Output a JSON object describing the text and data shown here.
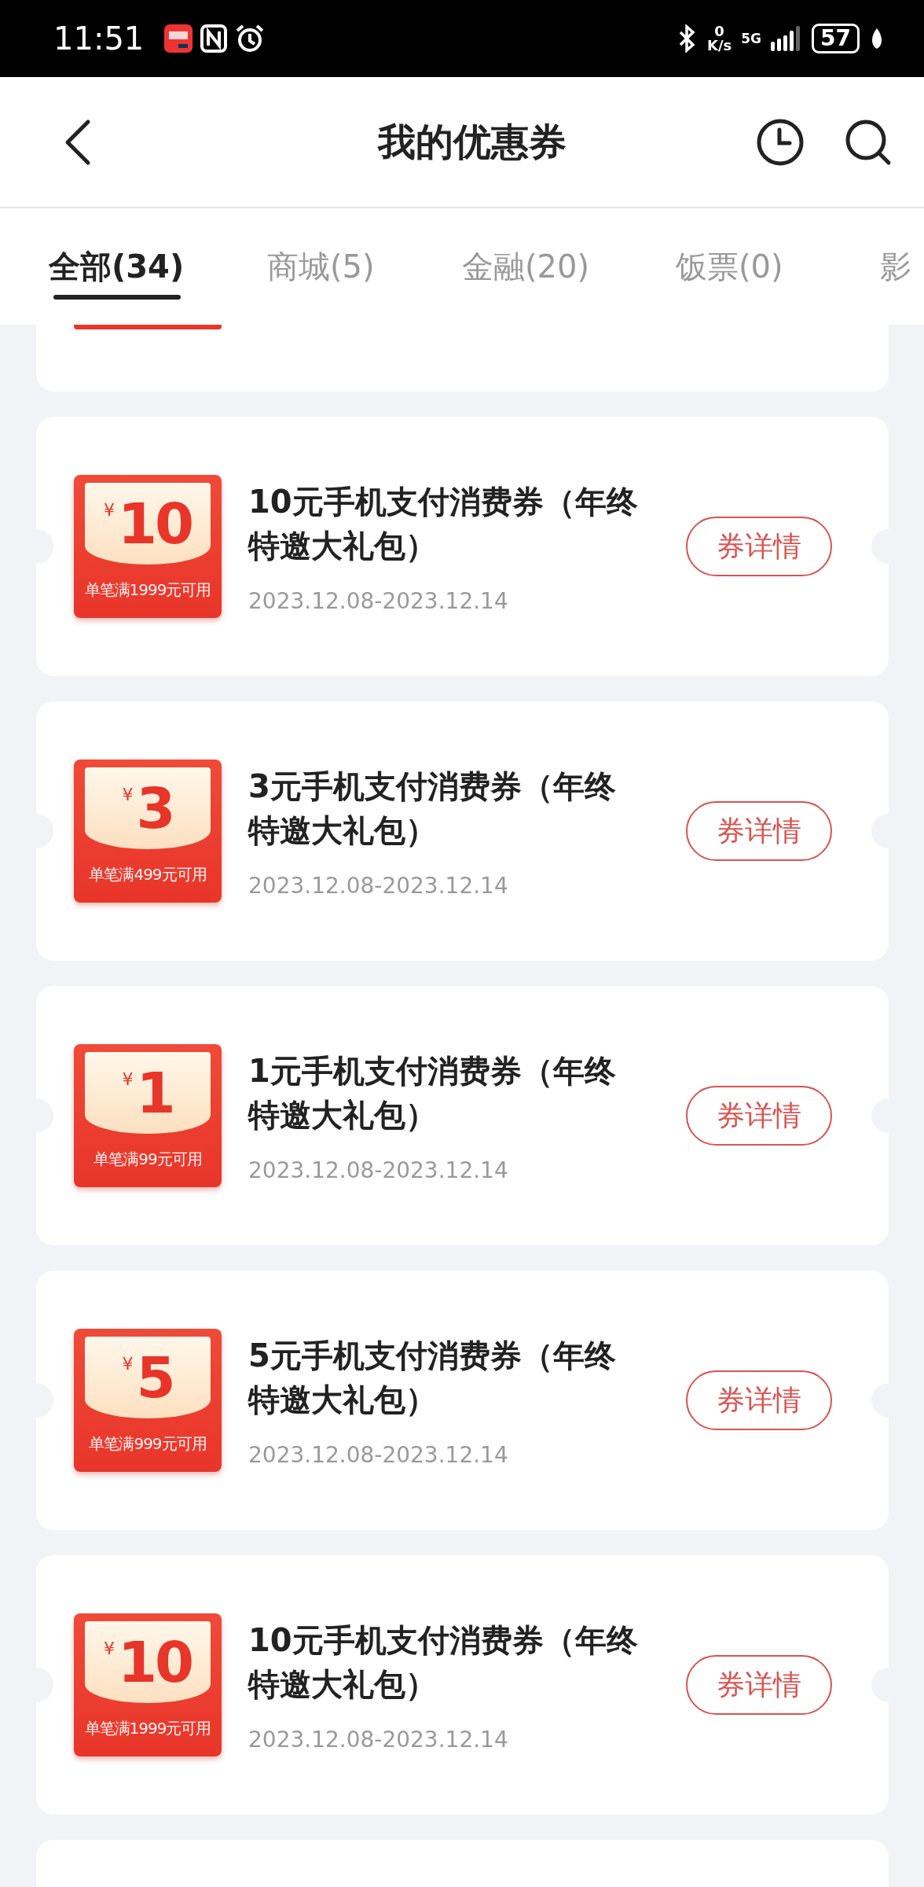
{
  "status_bar": {
    "time": "11:51",
    "net_speed": "0",
    "net_unit": "K/s",
    "network": "5G",
    "battery": "57"
  },
  "header": {
    "title": "我的优惠券"
  },
  "tabs": [
    {
      "label": "全部(34)",
      "selected": true
    },
    {
      "label": "商城(5)",
      "selected": false
    },
    {
      "label": "金融(20)",
      "selected": false
    },
    {
      "label": "饭票(0)",
      "selected": false
    },
    {
      "label": "影",
      "selected": false
    }
  ],
  "coupons": [
    {
      "currency": "¥",
      "amount": "10",
      "condition": "单笔满1999元可用",
      "title": "10元手机支付消费券（年终特邀大礼包）",
      "dates": "2023.12.08-2023.12.14",
      "button": "券详情"
    },
    {
      "currency": "¥",
      "amount": "3",
      "condition": "单笔满499元可用",
      "title": "3元手机支付消费券（年终特邀大礼包）",
      "dates": "2023.12.08-2023.12.14",
      "button": "券详情"
    },
    {
      "currency": "¥",
      "amount": "1",
      "condition": "单笔满99元可用",
      "title": "1元手机支付消费券（年终特邀大礼包）",
      "dates": "2023.12.08-2023.12.14",
      "button": "券详情"
    },
    {
      "currency": "¥",
      "amount": "5",
      "condition": "单笔满999元可用",
      "title": "5元手机支付消费券（年终特邀大礼包）",
      "dates": "2023.12.08-2023.12.14",
      "button": "券详情"
    },
    {
      "currency": "¥",
      "amount": "10",
      "condition": "单笔满1999元可用",
      "title": "10元手机支付消费券（年终特邀大礼包）",
      "dates": "2023.12.08-2023.12.14",
      "button": "券详情"
    }
  ]
}
